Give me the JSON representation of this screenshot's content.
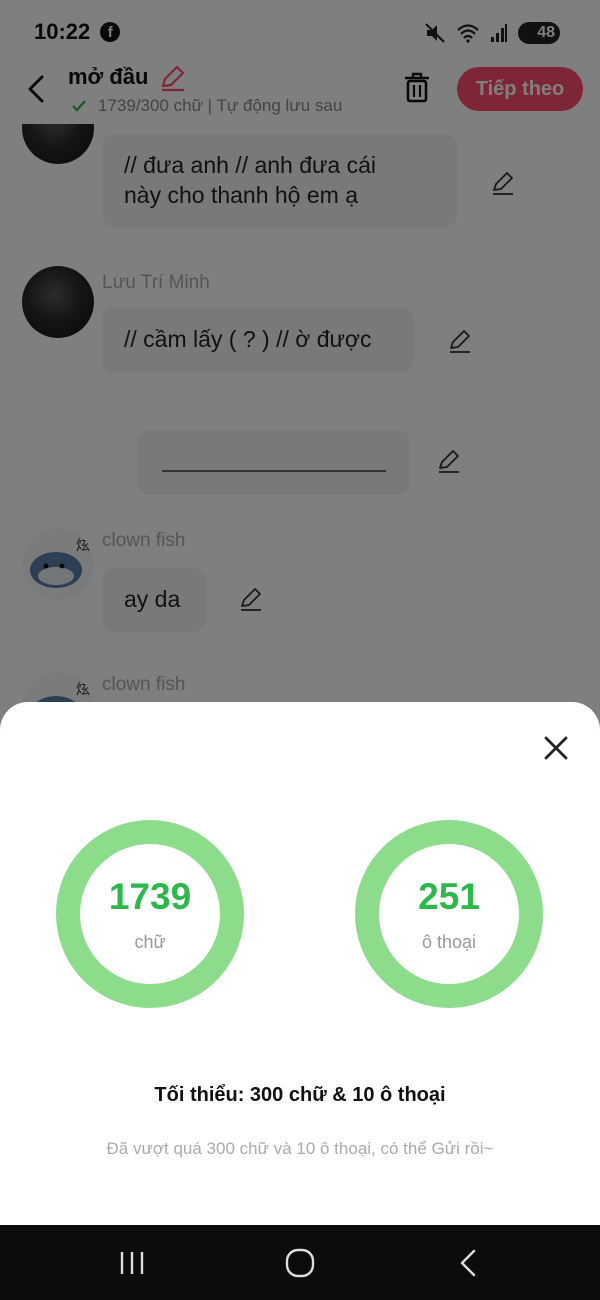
{
  "status_bar": {
    "time": "10:22",
    "battery": "48",
    "icons": [
      "facebook-icon",
      "mute-icon",
      "wifi-icon",
      "signal-icon",
      "battery-icon"
    ]
  },
  "header": {
    "title": "mở đầu",
    "subtitle": "1739/300 chữ | Tự động lưu sau",
    "next_label": "Tiếp theo"
  },
  "chat": {
    "messages": [
      {
        "speaker": "",
        "text_lines": [
          "// đưa anh // anh đưa cái",
          "này cho thanh hộ em ạ"
        ]
      },
      {
        "speaker": "Lưu Trí Minh",
        "text_lines": [
          "// cầm lấy ( ? ) // ờ được"
        ]
      },
      {
        "speaker": "",
        "text_lines": [
          ""
        ]
      },
      {
        "speaker": "clown fish",
        "text_lines": [
          "ay da"
        ]
      },
      {
        "speaker": "clown fish",
        "text_lines": [
          ""
        ]
      }
    ]
  },
  "stats": {
    "words": {
      "value": "1739",
      "label": "chữ"
    },
    "dialogs": {
      "value": "251",
      "label": "ô thoại"
    },
    "minimum": "Tối thiểu: 300 chữ & 10 ô thoại",
    "hint": "Đã vượt quá 300 chữ và 10 ô thoại, có thể Gửi rồi~"
  },
  "colors": {
    "accent": "#ff4d6d",
    "ring": "#8cdc8c",
    "ring_text": "#2db84a"
  }
}
